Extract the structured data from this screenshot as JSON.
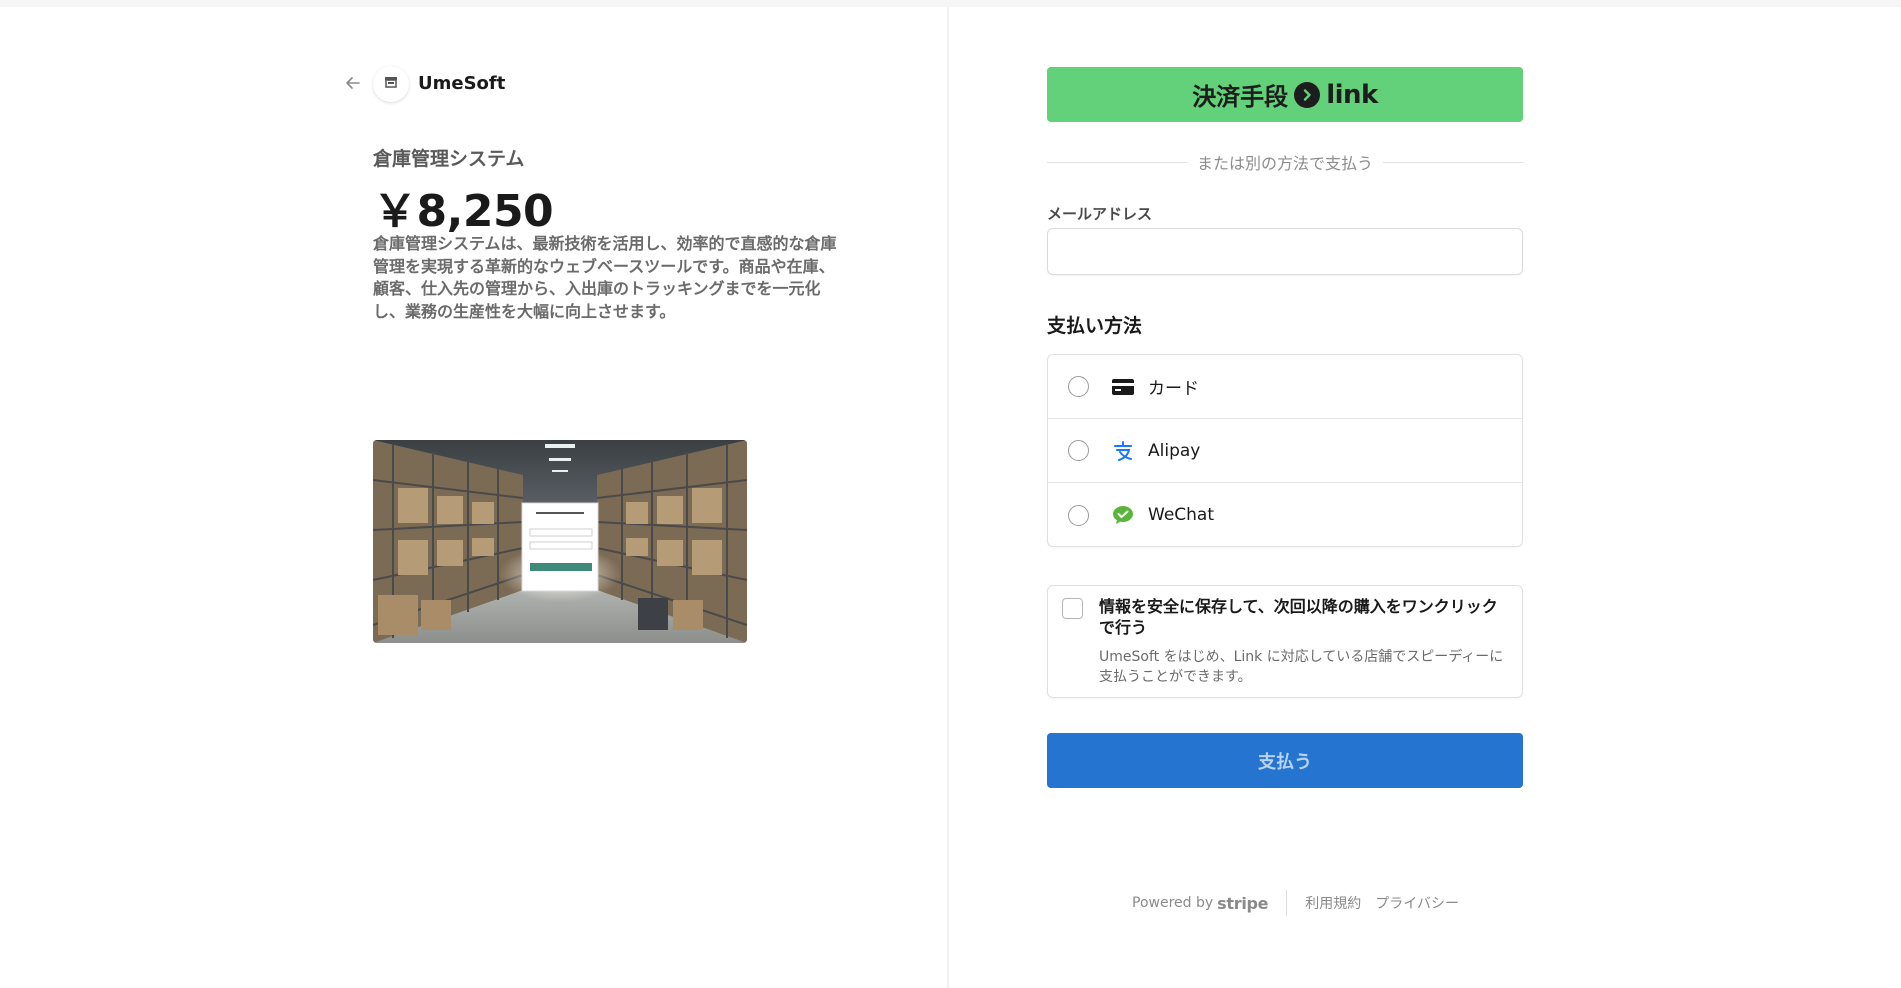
{
  "merchant": {
    "name": "UmeSoft"
  },
  "product": {
    "name": "倉庫管理システム",
    "price": "￥8,250",
    "description": "倉庫管理システムは、最新技術を活用し、効率的で直感的な倉庫管理を実現する革新的なウェブベースツールです。商品や在庫、顧客、仕入先の管理から、入出庫のトラッキングまでを一元化し、業務の生産性を大幅に向上させます。"
  },
  "link_button": {
    "label": "決済手段",
    "brand": "link"
  },
  "divider_text": "または別の方法で支払う",
  "email": {
    "label": "メールアドレス",
    "value": "",
    "placeholder": ""
  },
  "payment_methods": {
    "title": "支払い方法",
    "items": [
      {
        "label": "カード",
        "icon": "credit-card-icon"
      },
      {
        "label": "Alipay",
        "icon": "alipay-icon"
      },
      {
        "label": "WeChat",
        "icon": "wechat-icon"
      }
    ]
  },
  "save_info": {
    "title": "情報を安全に保存して、次回以降の購入をワンクリックで行う",
    "description": "UmeSoft をはじめ、Link に対応している店舗でスピーディーに支払うことができます。"
  },
  "pay_button": {
    "label": "支払う"
  },
  "footer": {
    "powered_by": "Powered by",
    "brand": "stripe",
    "terms": "利用規約",
    "privacy": "プライバシー"
  },
  "colors": {
    "link_green": "#63d07a",
    "pay_blue": "#2575d0",
    "alipay_blue": "#1677ff",
    "wechat_green": "#5bb53d"
  }
}
